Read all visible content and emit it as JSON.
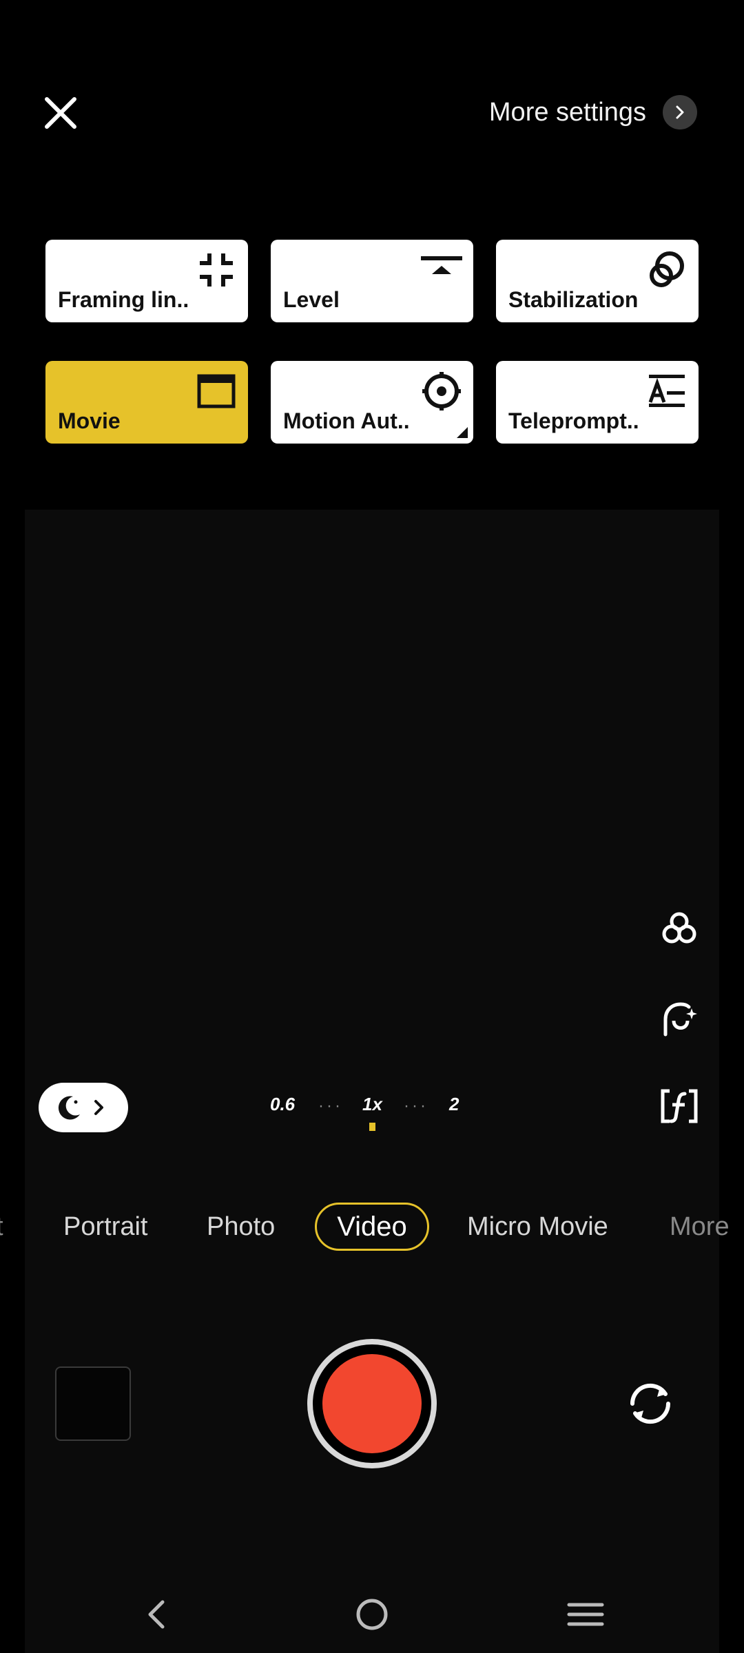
{
  "header": {
    "more_settings_label": "More settings"
  },
  "quick_settings": {
    "framing_lines": "Framing lin..",
    "level": "Level",
    "stabilization": "Stabilization",
    "movie": "Movie",
    "motion_auto": "Motion Aut..",
    "teleprompter": "Teleprompt.."
  },
  "zoom": {
    "z1": "0.6",
    "z2": "1x",
    "z3": "2",
    "dots": "···",
    "selected": "1x"
  },
  "modes": {
    "portrait": "Portrait",
    "photo": "Photo",
    "video": "Video",
    "micro_movie": "Micro Movie",
    "more": "More",
    "selected": "Video"
  },
  "colors": {
    "accent": "#e6c22a",
    "record": "#f2472f",
    "tile_bg": "#ffffff"
  },
  "icons": [
    "close-icon",
    "chevron-right-icon",
    "framing-lines-icon",
    "level-icon",
    "stabilization-icon",
    "clapperboard-icon",
    "motion-target-icon",
    "teleprompter-icon",
    "filters-icon",
    "beauty-icon",
    "focus-peaking-icon",
    "night-moon-icon",
    "switch-camera-icon",
    "back-icon",
    "home-icon",
    "menu-icon"
  ]
}
